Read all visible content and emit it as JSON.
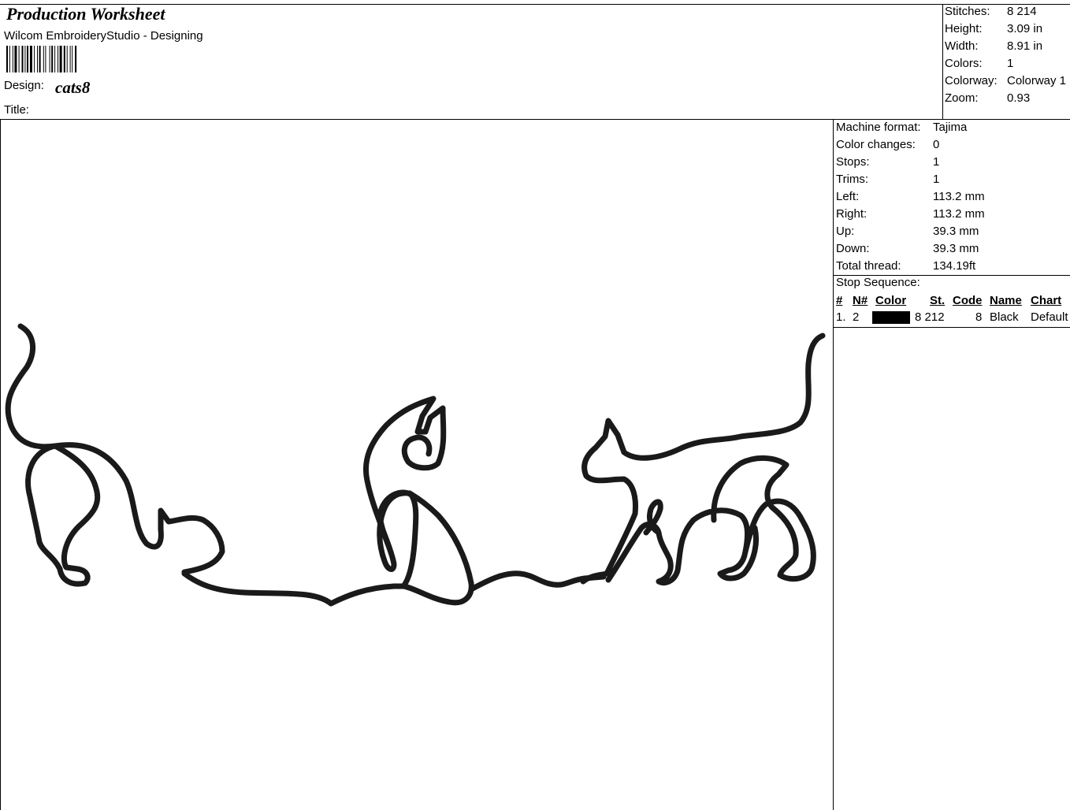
{
  "header": {
    "title": "Production Worksheet",
    "app": "Wilcom EmbroideryStudio - Designing",
    "design_label": "Design:",
    "design_value": "cats8",
    "title_label": "Title:"
  },
  "summary": [
    {
      "label": "Stitches:",
      "value": "8 214"
    },
    {
      "label": "Height:",
      "value": "3.09 in"
    },
    {
      "label": "Width:",
      "value": "8.91 in"
    },
    {
      "label": "Colors:",
      "value": "1"
    },
    {
      "label": "Colorway:",
      "value": "Colorway 1"
    },
    {
      "label": "Zoom:",
      "value": "0.93"
    }
  ],
  "machine": [
    {
      "label": "Machine format:",
      "value": "Tajima"
    },
    {
      "label": "Color changes:",
      "value": "0"
    },
    {
      "label": "Stops:",
      "value": "1"
    },
    {
      "label": "Trims:",
      "value": "1"
    },
    {
      "label": "Left:",
      "value": "113.2 mm"
    },
    {
      "label": "Right:",
      "value": "113.2 mm"
    },
    {
      "label": "Up:",
      "value": "39.3 mm"
    },
    {
      "label": "Down:",
      "value": "39.3 mm"
    },
    {
      "label": "Total thread:",
      "value": "134.19ft"
    }
  ],
  "stop_sequence": {
    "label": "Stop Sequence:",
    "headers": {
      "num": "#",
      "n": "N#",
      "color": "Color",
      "st": "St.",
      "code": "Code",
      "name": "Name",
      "chart": "Chart"
    },
    "rows": [
      {
        "num": "1.",
        "n": "2",
        "color_hex": "#000000",
        "st": "8 212",
        "code": "8",
        "name": "Black",
        "chart": "Default"
      }
    ]
  },
  "colors": {
    "thread": "#1a1a1a",
    "border": "#000000"
  }
}
